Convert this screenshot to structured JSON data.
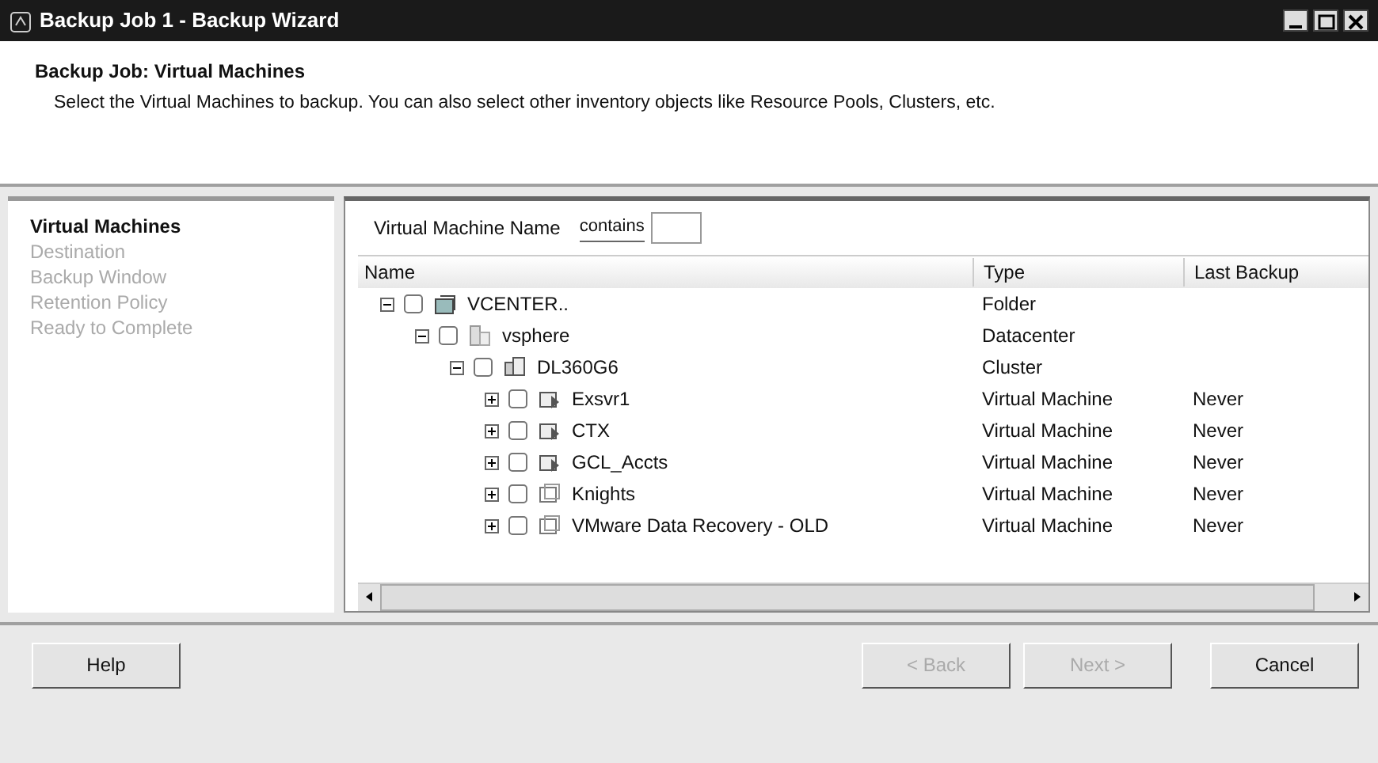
{
  "window": {
    "title": "Backup Job 1 - Backup Wizard"
  },
  "header": {
    "title": "Backup Job: Virtual Machines",
    "description": "Select the Virtual Machines to backup. You can also select other inventory objects like Resource Pools, Clusters, etc."
  },
  "steps": [
    {
      "label": "Virtual Machines",
      "selected": true
    },
    {
      "label": "Destination",
      "selected": false
    },
    {
      "label": "Backup Window",
      "selected": false
    },
    {
      "label": "Retention Policy",
      "selected": false
    },
    {
      "label": "Ready to Complete",
      "selected": false
    }
  ],
  "filter": {
    "label": "Virtual Machine Name",
    "operator": "contains"
  },
  "table": {
    "columns": [
      "Name",
      "Type",
      "Last Backup"
    ],
    "rows": [
      {
        "name": "VCENTER..",
        "kind": "folder",
        "type": "Folder",
        "expanded": true,
        "checked": false,
        "children": [
          {
            "name": "vsphere",
            "kind": "datacenter",
            "type": "Datacenter",
            "expanded": true,
            "checked": false,
            "children": [
              {
                "name": "DL360G6",
                "kind": "cluster",
                "type": "Cluster",
                "expanded": true,
                "checked": false,
                "children": [
                  {
                    "name": "Exsvr1",
                    "kind": "vm-on",
                    "type": "Virtual Machine",
                    "last_backup": "Never",
                    "expanded": false,
                    "checked": false
                  },
                  {
                    "name": "CTX",
                    "kind": "vm-on",
                    "type": "Virtual Machine",
                    "last_backup": "Never",
                    "expanded": false,
                    "checked": false
                  },
                  {
                    "name": "GCL_Accts",
                    "kind": "vm-on",
                    "type": "Virtual Machine",
                    "last_backup": "Never",
                    "expanded": false,
                    "checked": false
                  },
                  {
                    "name": "Knights",
                    "kind": "vm-off",
                    "type": "Virtual Machine",
                    "last_backup": "Never",
                    "expanded": false,
                    "checked": false
                  },
                  {
                    "name": "VMware Data Recovery - OLD",
                    "kind": "vm-off",
                    "type": "Virtual Machine",
                    "last_backup": "Never",
                    "expanded": false,
                    "checked": false
                  }
                ]
              }
            ]
          }
        ]
      }
    ]
  },
  "buttons": [
    {
      "label": "Help",
      "disabled": false
    },
    {
      "label": "< Back",
      "disabled": true
    },
    {
      "label": "Next >",
      "disabled": true
    },
    {
      "label": "Cancel",
      "disabled": false
    }
  ]
}
